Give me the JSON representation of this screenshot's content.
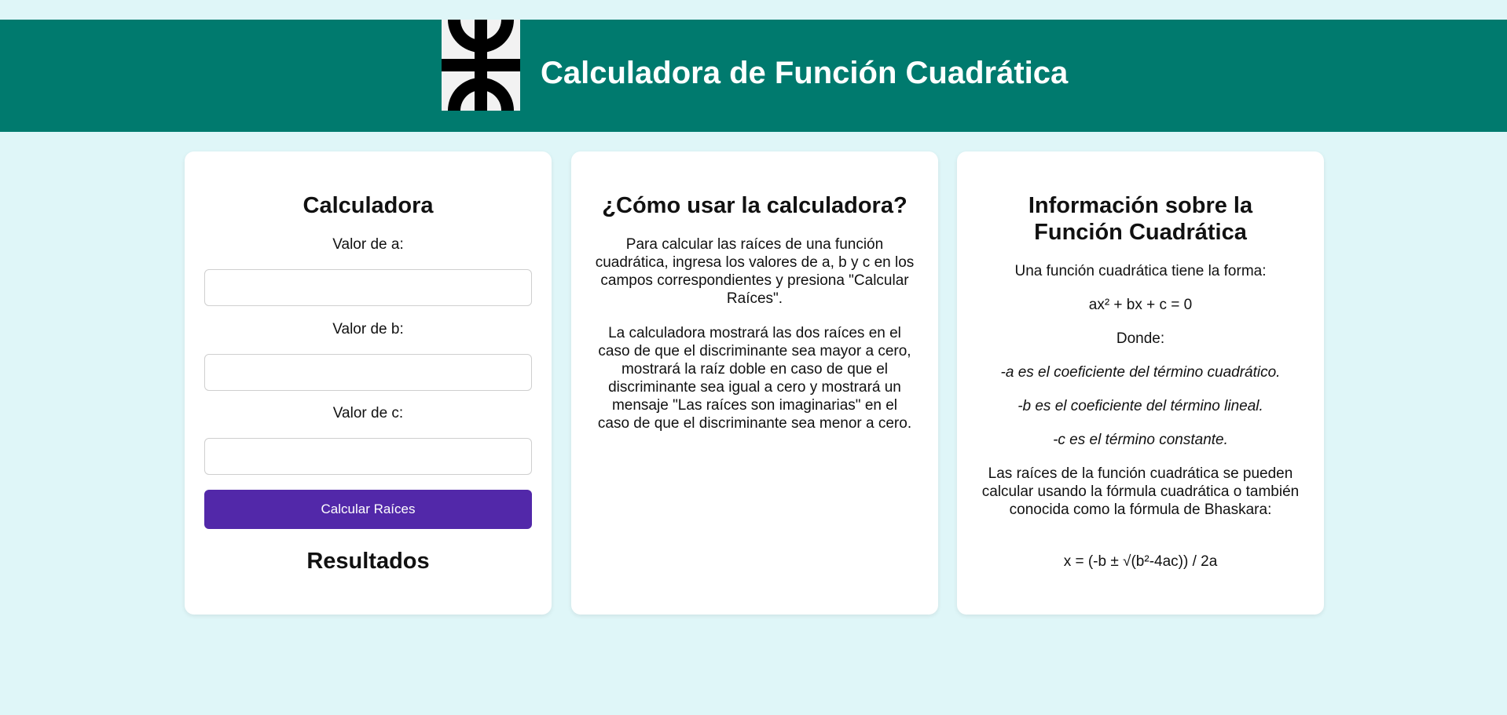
{
  "header": {
    "title": "Calculadora de Función Cuadrática",
    "logo_icon": "utn-logo-icon"
  },
  "colors": {
    "page_background": "#dff6f8",
    "header_background": "#007a6e",
    "button_background": "#5228a9",
    "card_background": "#ffffff"
  },
  "calculator": {
    "title": "Calculadora",
    "label_a": "Valor de a:",
    "label_b": "Valor de b:",
    "label_c": "Valor de c:",
    "value_a": "",
    "value_b": "",
    "value_c": "",
    "button_label": "Calcular Raíces",
    "results_title": "Resultados"
  },
  "howto": {
    "title": "¿Cómo usar la calculadora?",
    "paragraph_1": "Para calcular las raíces de una función cuadrática, ingresa los valores de a, b y c en los campos correspondientes y presiona \"Calcular Raíces\".",
    "paragraph_2": "La calculadora mostrará las dos raíces en el caso de que el discriminante sea mayor a cero, mostrará la raíz doble en caso de que el discriminante sea igual a cero y mostrará un mensaje \"Las raíces son imaginarias\" en el caso de que el discriminante sea menor a cero."
  },
  "info": {
    "title": "Información sobre la Función Cuadrática",
    "intro": "Una función cuadrática tiene la forma:",
    "formula": "ax² + bx + c = 0",
    "where": "Donde:",
    "coef_a": "-a es el coeficiente del término cuadrático.",
    "coef_b": "-b es el coeficiente del término lineal.",
    "coef_c": "-c es el término constante.",
    "roots_text": "Las raíces de la función cuadrática se pueden calcular usando la fórmula cuadrática o también conocida como la fórmula de Bhaskara:",
    "roots_formula": "x = (-b ± √(b²-4ac)) / 2a"
  }
}
